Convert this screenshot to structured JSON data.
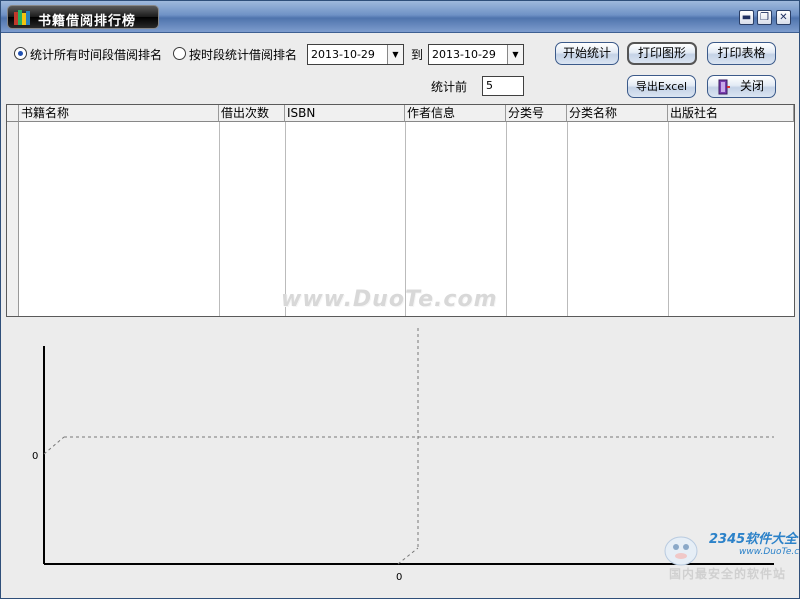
{
  "window": {
    "title": "书籍借阅排行榜"
  },
  "window_controls": {
    "minimize": "▬",
    "restore": "❐",
    "close": "✕"
  },
  "filters": {
    "mode_all_label": "统计所有时间段借阅排名",
    "mode_period_label": "按时段统计借阅排名",
    "mode_all_checked": true,
    "start_date": "2013-10-29",
    "to_label": "到",
    "end_date": "2013-10-29",
    "top_label": "统计前",
    "top_value": "5"
  },
  "buttons": {
    "start_stats": "开始统计",
    "print_chart": "打印图形",
    "print_table": "打印表格",
    "export_excel": "导出Excel",
    "close": "关闭"
  },
  "table": {
    "columns": [
      "书籍名称",
      "借出次数",
      "ISBN",
      "作者信息",
      "分类号",
      "分类名称",
      "出版社名"
    ],
    "rows": []
  },
  "chart_data": {
    "type": "bar",
    "categories": [],
    "values": [],
    "x_tick_labels": [
      "0"
    ],
    "y_tick_labels": [
      "0"
    ],
    "title": "",
    "xlabel": "",
    "ylabel": "",
    "grid": true
  },
  "watermark": "www.DuoTe.com",
  "brand": {
    "name": "2345软件大全",
    "url": "www.DuoTe.com",
    "slogan": "国内最安全的软件站"
  },
  "colors": {
    "title_bar": "#6f92c6",
    "title_tab": "#1a1a1a",
    "accent": "#2050b0",
    "brand": "#2c82c9"
  }
}
